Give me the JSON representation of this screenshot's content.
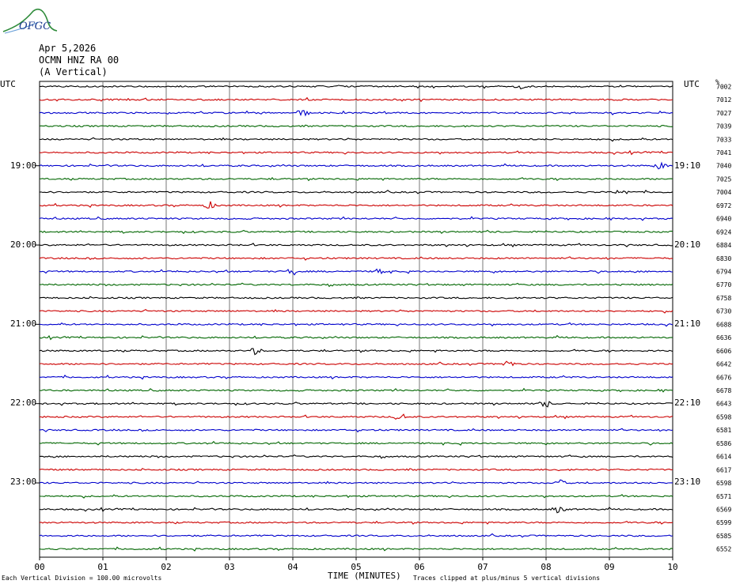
{
  "header": {
    "logo_text": "OFGC",
    "date": "Apr 5,2026",
    "station": "OCMN HNZ RA 00",
    "component": "(A Vertical)"
  },
  "left_axis": {
    "label": "UTC",
    "hour_labels": [
      "19:00",
      "20:00",
      "21:00",
      "22:00",
      "23:00"
    ]
  },
  "right_axis": {
    "label": "UTC",
    "unit_label": "%",
    "hour_labels": [
      "19:10",
      "20:10",
      "21:10",
      "22:10",
      "23:10"
    ]
  },
  "footer": {
    "scale_note": "Each Vertical Division =  100.00 microvolts",
    "x_title": "TIME (MINUTES)",
    "clip_note": "Traces clipped at plus/minus 5 vertical divisions"
  },
  "chart_data": {
    "type": "line",
    "title": "",
    "xlabel": "TIME (MINUTES)",
    "ylabel": "",
    "x_ticks": [
      "00",
      "01",
      "02",
      "03",
      "04",
      "05",
      "06",
      "07",
      "08",
      "09",
      "10"
    ],
    "xlim": [
      0,
      10
    ],
    "grid": true,
    "trace_colors": [
      "#000000",
      "#cc0000",
      "#0000cc",
      "#006600"
    ],
    "right_values": [
      "7002",
      "7012",
      "7027",
      "7039",
      "7033",
      "7041",
      "7040",
      "7025",
      "7004",
      "6972",
      "6940",
      "6924",
      "6884",
      "6830",
      "6794",
      "6770",
      "6758",
      "6730",
      "6688",
      "6636",
      "6606",
      "6642",
      "6676",
      "6678",
      "6643",
      "6598",
      "6581",
      "6586",
      "6614",
      "6617",
      "6598",
      "6571",
      "6569",
      "6599",
      "6585",
      "6552"
    ],
    "hour_rows": [
      6,
      12,
      18,
      24,
      30
    ],
    "events": [
      {
        "row": 0,
        "minute": 7.6
      },
      {
        "row": 2,
        "minute": 4.15
      },
      {
        "row": 6,
        "minute": 9.8
      },
      {
        "row": 8,
        "minute": 9.2
      },
      {
        "row": 9,
        "minute": 2.7
      },
      {
        "row": 14,
        "minute": 4.0
      },
      {
        "row": 14,
        "minute": 5.4
      },
      {
        "row": 20,
        "minute": 3.4
      },
      {
        "row": 21,
        "minute": 7.4
      },
      {
        "row": 24,
        "minute": 8.0
      },
      {
        "row": 25,
        "minute": 5.7
      },
      {
        "row": 30,
        "minute": 8.2
      },
      {
        "row": 32,
        "minute": 8.2
      }
    ]
  }
}
